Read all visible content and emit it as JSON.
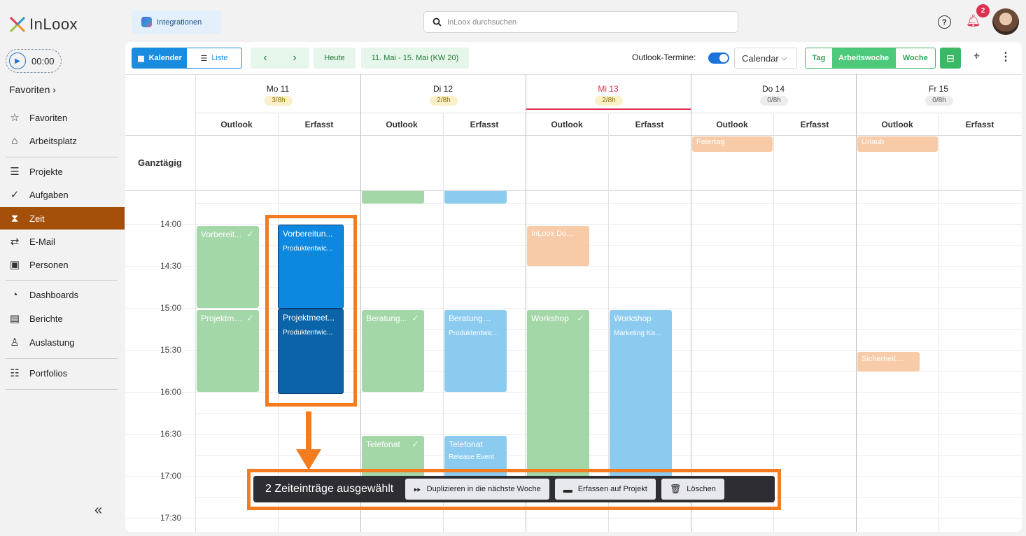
{
  "app": {
    "logo_text": "InLoox",
    "timer": "00:00"
  },
  "sidebar": {
    "favorites_header": "Favoriten",
    "items": [
      {
        "label": "Favoriten",
        "icon": "star-icon"
      },
      {
        "label": "Arbeitsplatz",
        "icon": "home-icon"
      },
      {
        "label": "Projekte",
        "icon": "layers-icon"
      },
      {
        "label": "Aufgaben",
        "icon": "check-circle-icon"
      },
      {
        "label": "Zeit",
        "icon": "hourglass-icon"
      },
      {
        "label": "E-Mail",
        "icon": "mail-route-icon"
      },
      {
        "label": "Personen",
        "icon": "contact-card-icon"
      },
      {
        "label": "Dashboards",
        "icon": "pie-chart-icon"
      },
      {
        "label": "Berichte",
        "icon": "document-icon"
      },
      {
        "label": "Auslastung",
        "icon": "workload-icon"
      },
      {
        "label": "Portfolios",
        "icon": "portfolio-list-icon"
      }
    ],
    "collapse": "«"
  },
  "topbar": {
    "integrations": "Integrationen",
    "search_placeholder": "InLoox durchsuchen",
    "notification_count": "2",
    "help": "?"
  },
  "toolbar": {
    "calendar": "Kalender",
    "list": "Liste",
    "today": "Heute",
    "range": "11. Mai - 15. Mai (KW 20)",
    "outlook_label": "Outlook-Termine:",
    "calendar_dropdown": "Calendar",
    "view_day": "Tag",
    "view_workweek": "Arbeitswoche",
    "view_week": "Woche"
  },
  "days": [
    {
      "name": "Mo 11",
      "hours": "3/8h",
      "today": false
    },
    {
      "name": "Di 12",
      "hours": "2/8h",
      "today": false
    },
    {
      "name": "Mi 13",
      "hours": "2/8h",
      "today": true
    },
    {
      "name": "Do 14",
      "hours": "0/8h",
      "today": false
    },
    {
      "name": "Fr 15",
      "hours": "0/8h",
      "today": false
    }
  ],
  "columns": {
    "outlook": "Outlook",
    "erfasst": "Erfasst"
  },
  "allday_label": "Ganztägig",
  "times": [
    "14:00",
    "14:30",
    "15:00",
    "15:30",
    "16:00",
    "16:30",
    "17:00",
    "17:30"
  ],
  "events": {
    "feiertag": "Feiertag",
    "urlaub": "Urlaub",
    "mo_o1": "Vorbereit...",
    "mo_e1_title": "Vorbereitun...",
    "mo_e1_sub": "Produktentwic...",
    "mo_o2": "Projektme...",
    "mo_e2_title": "Projektmeet...",
    "mo_e2_sub": "Produktentwic...",
    "di_o1": "Beratung...",
    "di_e1_title": "Beratungste...",
    "di_e1_sub": "Produktentwic...",
    "di_o2": "Telefonat",
    "di_e2_title": "Telefonat",
    "di_e2_sub": "Release Event",
    "mi_docs": "InLoox Docs ...",
    "mi_o1": "Workshop",
    "mi_e1_title": "Workshop",
    "mi_e1_sub": "Marketing Ka...",
    "fr_sich": "Sicherheits..."
  },
  "action_bar": {
    "selection": "2 Zeiteinträge ausgewählt",
    "duplicate": "Duplizieren in die nächste Woche",
    "assign": "Erfassen auf Projekt",
    "delete": "Löschen"
  },
  "colors": {
    "accent_active_nav": "#a44f0a",
    "outlook_event": "#a3d7a8",
    "recorded_event": "#8ccbf0",
    "holiday_event": "#f8cba8",
    "highlight": "#f47c20",
    "today": "#e0304f"
  }
}
